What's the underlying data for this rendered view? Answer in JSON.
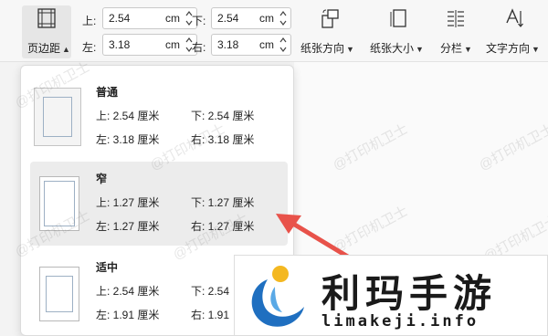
{
  "toolbar": {
    "page_margin_label": "页边距",
    "margins": {
      "top": {
        "label": "上:",
        "value": "2.54",
        "unit": "cm"
      },
      "bottom": {
        "label": "下:",
        "value": "2.54",
        "unit": "cm"
      },
      "left": {
        "label": "左:",
        "value": "3.18",
        "unit": "cm"
      },
      "right": {
        "label": "右:",
        "value": "3.18",
        "unit": "cm"
      }
    },
    "orientation_label": "纸张方向",
    "size_label": "纸张大小",
    "columns_label": "分栏",
    "text_direction_label": "文字方向"
  },
  "presets": [
    {
      "name": "普通",
      "top": "上: 2.54 厘米",
      "bottom": "下: 2.54 厘米",
      "left": "左: 3.18 厘米",
      "right": "右: 3.18 厘米"
    },
    {
      "name": "窄",
      "top": "上: 1.27 厘米",
      "bottom": "下: 1.27 厘米",
      "left": "左: 1.27 厘米",
      "right": "右: 1.27 厘米"
    },
    {
      "name": "适中",
      "top": "上: 2.54 厘米",
      "bottom": "下: 2.54",
      "left": "左: 1.91 厘米",
      "right": "右: 1.91"
    }
  ],
  "watermark_text": "@打印机卫士",
  "logo": {
    "chinese": "利玛手游",
    "domain": "limakeji.info"
  },
  "colors": {
    "arrow": "#e8524a",
    "logo_blue": "#1f6fc0",
    "logo_yellow": "#f4b821"
  }
}
